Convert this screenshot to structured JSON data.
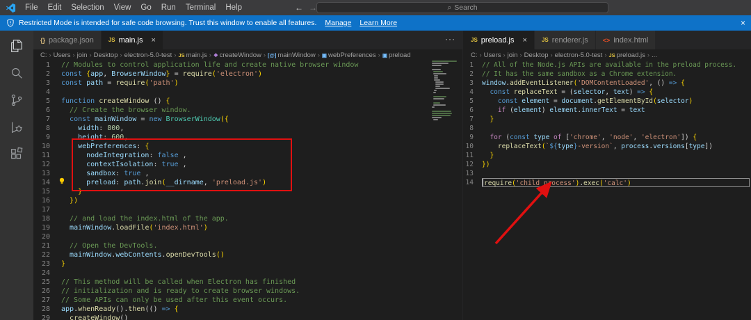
{
  "colors": {
    "annotation_red": "#e01010",
    "banner_blue": "#0e72c8",
    "accent": "#0078d4"
  },
  "breadcrumb_separator": "›",
  "title_bar": {
    "menus": [
      "File",
      "Edit",
      "Selection",
      "View",
      "Go",
      "Run",
      "Terminal",
      "Help"
    ],
    "nav_back": "←",
    "nav_forward": "→",
    "search_icon": "⌕",
    "search_placeholder": "Search"
  },
  "banner": {
    "icon": "shield-icon",
    "text": "Restricted Mode is intended for safe code browsing. Trust this window to enable all features.",
    "manage_label": "Manage",
    "learn_more_label": "Learn More",
    "close": "×"
  },
  "activity_bar": {
    "items": [
      "explorer",
      "search",
      "source-control",
      "run-and-debug",
      "extensions"
    ]
  },
  "left_group": {
    "tabs": [
      {
        "icon": "json",
        "label": "package.json",
        "active": false,
        "close": ""
      },
      {
        "icon": "js",
        "label": "main.js",
        "active": true,
        "close": "×"
      }
    ],
    "more_actions": "···",
    "breadcrumb": [
      {
        "label": "C:"
      },
      {
        "label": "Users"
      },
      {
        "label": "join"
      },
      {
        "label": "Desktop"
      },
      {
        "label": "electron-5.0-test"
      },
      {
        "label": "main.js",
        "icon": "js"
      },
      {
        "label": "createWindow",
        "icon": "method"
      },
      {
        "label": "mainWindow",
        "icon": "variable"
      },
      {
        "label": "webPreferences",
        "icon": "property"
      },
      {
        "label": "preload",
        "icon": "property"
      }
    ],
    "code": [
      [
        [
          "cm",
          "// Modules to control application life and create native browser window"
        ]
      ],
      [
        [
          "kw",
          "const "
        ],
        [
          "br",
          "{"
        ],
        [
          "vr",
          "app"
        ],
        [
          "pl",
          ", "
        ],
        [
          "vr",
          "BrowserWindow"
        ],
        [
          "br",
          "}"
        ],
        [
          "pl",
          " = "
        ],
        [
          "fn",
          "require"
        ],
        [
          "br",
          "("
        ],
        [
          "st",
          "'electron'"
        ],
        [
          "br",
          ")"
        ]
      ],
      [
        [
          "kw",
          "const "
        ],
        [
          "vr",
          "path"
        ],
        [
          "pl",
          " = "
        ],
        [
          "fn",
          "require"
        ],
        [
          "br",
          "("
        ],
        [
          "st",
          "'path'"
        ],
        [
          "br",
          ")"
        ]
      ],
      [],
      [
        [
          "kw",
          "function "
        ],
        [
          "fn",
          "createWindow"
        ],
        [
          "pl",
          " () "
        ],
        [
          "br",
          "{"
        ]
      ],
      [
        [
          "cm",
          "  // Create the browser window."
        ]
      ],
      [
        [
          "pl",
          "  "
        ],
        [
          "kw",
          "const "
        ],
        [
          "vr",
          "mainWindow"
        ],
        [
          "pl",
          " = "
        ],
        [
          "kw",
          "new "
        ],
        [
          "cl",
          "BrowserWindow"
        ],
        [
          "br",
          "({"
        ]
      ],
      [
        [
          "pl",
          "    "
        ],
        [
          "vr",
          "width"
        ],
        [
          "pl",
          ": "
        ],
        [
          "nu",
          "800"
        ],
        [
          "pl",
          ","
        ]
      ],
      [
        [
          "pl",
          "    "
        ],
        [
          "vr",
          "height"
        ],
        [
          "pl",
          ": "
        ],
        [
          "nu",
          "600"
        ],
        [
          "pl",
          ","
        ]
      ],
      [
        [
          "pl",
          "    "
        ],
        [
          "vr",
          "webPreferences"
        ],
        [
          "pl",
          ": "
        ],
        [
          "br",
          "{"
        ]
      ],
      [
        [
          "pl",
          "      "
        ],
        [
          "vr",
          "nodeIntegration"
        ],
        [
          "pl",
          ": "
        ],
        [
          "kw",
          "false"
        ],
        [
          "pl",
          " ,"
        ]
      ],
      [
        [
          "pl",
          "      "
        ],
        [
          "vr",
          "contextIsolation"
        ],
        [
          "pl",
          ": "
        ],
        [
          "kw",
          "true"
        ],
        [
          "pl",
          " ,"
        ]
      ],
      [
        [
          "pl",
          "      "
        ],
        [
          "vr",
          "sandbox"
        ],
        [
          "pl",
          ": "
        ],
        [
          "kw",
          "true"
        ],
        [
          "pl",
          " ,"
        ]
      ],
      [
        [
          "pl",
          "      "
        ],
        [
          "vr",
          "preload"
        ],
        [
          "pl",
          ": "
        ],
        [
          "vr",
          "path"
        ],
        [
          "pl",
          "."
        ],
        [
          "fn",
          "join"
        ],
        [
          "br",
          "("
        ],
        [
          "vr",
          "__dirname"
        ],
        [
          "pl",
          ", "
        ],
        [
          "st",
          "'preload.js'"
        ],
        [
          "br",
          ")"
        ]
      ],
      [
        [
          "pl",
          "    "
        ],
        [
          "br",
          "}"
        ]
      ],
      [
        [
          "pl",
          "  "
        ],
        [
          "br",
          "})"
        ]
      ],
      [],
      [
        [
          "cm",
          "  // and load the index.html of the app."
        ]
      ],
      [
        [
          "pl",
          "  "
        ],
        [
          "vr",
          "mainWindow"
        ],
        [
          "pl",
          "."
        ],
        [
          "fn",
          "loadFile"
        ],
        [
          "br",
          "("
        ],
        [
          "st",
          "'index.html'"
        ],
        [
          "br",
          ")"
        ]
      ],
      [],
      [
        [
          "cm",
          "  // Open the DevTools."
        ]
      ],
      [
        [
          "pl",
          "  "
        ],
        [
          "vr",
          "mainWindow"
        ],
        [
          "pl",
          "."
        ],
        [
          "vr",
          "webContents"
        ],
        [
          "pl",
          "."
        ],
        [
          "fn",
          "openDevTools"
        ],
        [
          "br",
          "()"
        ]
      ],
      [
        [
          "br",
          "}"
        ]
      ],
      [],
      [
        [
          "cm",
          "// This method will be called when Electron has finished"
        ]
      ],
      [
        [
          "cm",
          "// initialization and is ready to create browser windows."
        ]
      ],
      [
        [
          "cm",
          "// Some APIs can only be used after this event occurs."
        ]
      ],
      [
        [
          "vr",
          "app"
        ],
        [
          "pl",
          "."
        ],
        [
          "fn",
          "whenReady"
        ],
        [
          "pl",
          "()."
        ],
        [
          "fn",
          "then"
        ],
        [
          "pl",
          "(() "
        ],
        [
          "kw",
          "=>"
        ],
        [
          "pl",
          " "
        ],
        [
          "br",
          "{"
        ]
      ],
      [
        [
          "pl",
          "  "
        ],
        [
          "fn",
          "createWindow"
        ],
        [
          "pl",
          "()"
        ]
      ]
    ]
  },
  "right_group": {
    "tabs": [
      {
        "icon": "js",
        "label": "preload.js",
        "active": true,
        "close": "×"
      },
      {
        "icon": "js",
        "label": "renderer.js",
        "active": false,
        "close": ""
      },
      {
        "icon": "html",
        "label": "index.html",
        "active": false,
        "close": ""
      }
    ],
    "breadcrumb": [
      {
        "label": "C:"
      },
      {
        "label": "Users"
      },
      {
        "label": "join"
      },
      {
        "label": "Desktop"
      },
      {
        "label": "electron-5.0-test"
      },
      {
        "label": "preload.js",
        "icon": "js"
      },
      {
        "label": "..."
      }
    ],
    "cursor_line": 14,
    "code": [
      [
        [
          "cm",
          "// All of the Node.js APIs are available in the preload process."
        ]
      ],
      [
        [
          "cm",
          "// It has the same sandbox as a Chrome extension."
        ]
      ],
      [
        [
          "vr",
          "window"
        ],
        [
          "pl",
          "."
        ],
        [
          "fn",
          "addEventListener"
        ],
        [
          "br",
          "("
        ],
        [
          "st",
          "'DOMContentLoaded'"
        ],
        [
          "pl",
          ", () "
        ],
        [
          "kw",
          "=>"
        ],
        [
          "pl",
          " "
        ],
        [
          "br",
          "{"
        ]
      ],
      [
        [
          "pl",
          "  "
        ],
        [
          "kw",
          "const "
        ],
        [
          "fn",
          "replaceText"
        ],
        [
          "pl",
          " = ("
        ],
        [
          "vr",
          "selector"
        ],
        [
          "pl",
          ", "
        ],
        [
          "vr",
          "text"
        ],
        [
          "pl",
          ") "
        ],
        [
          "kw",
          "=>"
        ],
        [
          "pl",
          " "
        ],
        [
          "br",
          "{"
        ]
      ],
      [
        [
          "pl",
          "    "
        ],
        [
          "kw",
          "const "
        ],
        [
          "vr",
          "element"
        ],
        [
          "pl",
          " = "
        ],
        [
          "vr",
          "document"
        ],
        [
          "pl",
          "."
        ],
        [
          "fn",
          "getElementById"
        ],
        [
          "br",
          "("
        ],
        [
          "vr",
          "selector"
        ],
        [
          "br",
          ")"
        ]
      ],
      [
        [
          "pl",
          "    "
        ],
        [
          "ct",
          "if"
        ],
        [
          "pl",
          " ("
        ],
        [
          "vr",
          "element"
        ],
        [
          "pl",
          ") "
        ],
        [
          "vr",
          "element"
        ],
        [
          "pl",
          "."
        ],
        [
          "vr",
          "innerText"
        ],
        [
          "pl",
          " = "
        ],
        [
          "vr",
          "text"
        ]
      ],
      [
        [
          "pl",
          "  "
        ],
        [
          "br",
          "}"
        ]
      ],
      [],
      [
        [
          "pl",
          "  "
        ],
        [
          "ct",
          "for"
        ],
        [
          "pl",
          " ("
        ],
        [
          "kw",
          "const "
        ],
        [
          "vr",
          "type"
        ],
        [
          "pl",
          " "
        ],
        [
          "ct",
          "of"
        ],
        [
          "pl",
          " ["
        ],
        [
          "st",
          "'chrome'"
        ],
        [
          "pl",
          ", "
        ],
        [
          "st",
          "'node'"
        ],
        [
          "pl",
          ", "
        ],
        [
          "st",
          "'electron'"
        ],
        [
          "pl",
          "]) "
        ],
        [
          "br",
          "{"
        ]
      ],
      [
        [
          "pl",
          "    "
        ],
        [
          "fn",
          "replaceText"
        ],
        [
          "br",
          "("
        ],
        [
          "st",
          "`"
        ],
        [
          "kw",
          "${"
        ],
        [
          "vr",
          "type"
        ],
        [
          "kw",
          "}"
        ],
        [
          "st",
          "-version`"
        ],
        [
          "pl",
          ", "
        ],
        [
          "vr",
          "process"
        ],
        [
          "pl",
          "."
        ],
        [
          "vr",
          "versions"
        ],
        [
          "pl",
          "["
        ],
        [
          "vr",
          "type"
        ],
        [
          "pl",
          "])"
        ]
      ],
      [
        [
          "pl",
          "  "
        ],
        [
          "br",
          "}"
        ]
      ],
      [
        [
          "br",
          "})"
        ]
      ],
      [],
      [
        [
          "fn",
          "require"
        ],
        [
          "br",
          "("
        ],
        [
          "st",
          "'child_process'"
        ],
        [
          "br",
          ")"
        ],
        [
          "pl",
          "."
        ],
        [
          "fn",
          "exec"
        ],
        [
          "br",
          "("
        ],
        [
          "st",
          "'calc'"
        ],
        [
          "br",
          ")"
        ]
      ]
    ]
  }
}
